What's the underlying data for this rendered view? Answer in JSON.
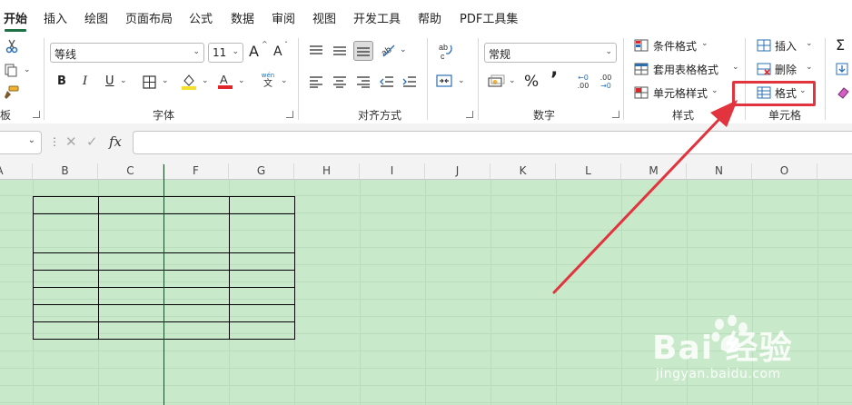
{
  "menu": {
    "tabs": [
      "开始",
      "插入",
      "绘图",
      "页面布局",
      "公式",
      "数据",
      "审阅",
      "视图",
      "开发工具",
      "帮助",
      "PDF工具集"
    ],
    "active": "开始"
  },
  "ribbon": {
    "clipboard": {
      "label_fragment": "板"
    },
    "font": {
      "label": "字体",
      "font_name": "等线",
      "font_size": "11",
      "bold": "B",
      "italic": "I",
      "underline": "U",
      "grow_font": "A",
      "shrink_font": "A",
      "phonetic_top": "wén",
      "phonetic_bottom": "文"
    },
    "alignment": {
      "label": "对齐方式"
    },
    "number": {
      "label": "数字",
      "format": "常规",
      "percent": "%",
      "comma": "’",
      "inc_decimal_top": "←0",
      "inc_decimal_bottom": ".00",
      "dec_decimal_top": ".00",
      "dec_decimal_bottom": "→0"
    },
    "styles": {
      "label": "样式",
      "conditional_format": "条件格式",
      "format_as_table": "套用表格格式",
      "cell_styles": "单元格样式"
    },
    "cells": {
      "label": "单元格",
      "insert": "插入",
      "delete": "删除",
      "format": "格式"
    },
    "editing": {
      "sum": "Σ"
    }
  },
  "formula_bar": {
    "fx": "fx",
    "value": ""
  },
  "columns": [
    "A",
    "B",
    "C",
    "F",
    "G",
    "H",
    "I",
    "J",
    "K",
    "L",
    "M",
    "N",
    "O"
  ],
  "colors": {
    "accent_green": "#1e7145",
    "sheet_background": "#c9e9cb",
    "annotation_red": "#e2343f"
  },
  "watermark": {
    "logo": "Bai 经验",
    "url": "jingyan.baidu.com"
  }
}
